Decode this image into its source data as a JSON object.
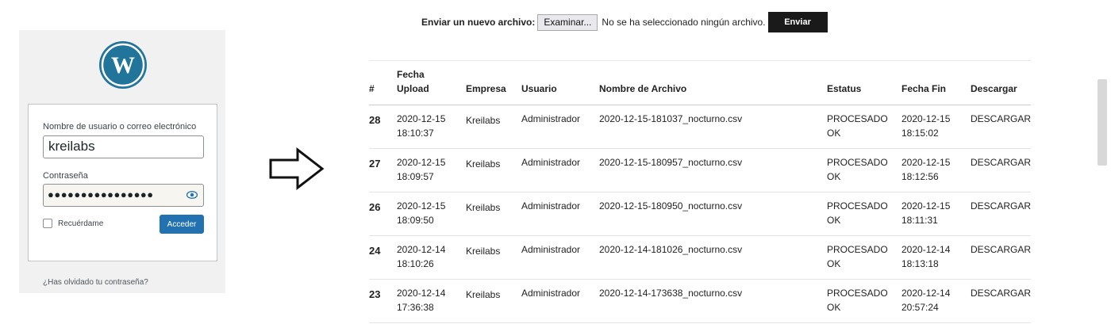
{
  "login": {
    "username_label": "Nombre de usuario o correo electrónico",
    "username_value": "kreilabs",
    "password_label": "Contraseña",
    "password_mask": "●●●●●●●●●●●●●●●●",
    "remember_label": "Recuérdame",
    "submit_label": "Acceder",
    "lost_password": "¿Has olvidado tu contraseña?",
    "brand_color": "#21759b"
  },
  "upload": {
    "label": "Enviar un nuevo archivo:",
    "browse_label": "Examinar...",
    "no_file_text": "No se ha seleccionado ningún archivo.",
    "send_label": "Enviar"
  },
  "table": {
    "headers": {
      "num": "#",
      "fecha_upload_1": "Fecha",
      "fecha_upload_2": "Upload",
      "empresa": "Empresa",
      "usuario": "Usuario",
      "archivo": "Nombre de Archivo",
      "estatus": "Estatus",
      "fecha_fin": "Fecha Fin",
      "descargar": "Descargar"
    },
    "rows": [
      {
        "num": "28",
        "upload_date": "2020-12-15",
        "upload_time": "18:10:37",
        "empresa": "Kreilabs",
        "usuario": "Administrador",
        "archivo": "2020-12-15-181037_nocturno.csv",
        "estatus_1": "PROCESADO",
        "estatus_2": "OK",
        "fin_date": "2020-12-15",
        "fin_time": "18:15:02",
        "descargar": "DESCARGAR"
      },
      {
        "num": "27",
        "upload_date": "2020-12-15",
        "upload_time": "18:09:57",
        "empresa": "Kreilabs",
        "usuario": "Administrador",
        "archivo": "2020-12-15-180957_nocturno.csv",
        "estatus_1": "PROCESADO",
        "estatus_2": "OK",
        "fin_date": "2020-12-15",
        "fin_time": "18:12:56",
        "descargar": "DESCARGAR"
      },
      {
        "num": "26",
        "upload_date": "2020-12-15",
        "upload_time": "18:09:50",
        "empresa": "Kreilabs",
        "usuario": "Administrador",
        "archivo": "2020-12-15-180950_nocturno.csv",
        "estatus_1": "PROCESADO",
        "estatus_2": "OK",
        "fin_date": "2020-12-15",
        "fin_time": "18:11:31",
        "descargar": "DESCARGAR"
      },
      {
        "num": "24",
        "upload_date": "2020-12-14",
        "upload_time": "18:10:26",
        "empresa": "Kreilabs",
        "usuario": "Administrador",
        "archivo": "2020-12-14-181026_nocturno.csv",
        "estatus_1": "PROCESADO",
        "estatus_2": "OK",
        "fin_date": "2020-12-14",
        "fin_time": "18:13:18",
        "descargar": "DESCARGAR"
      },
      {
        "num": "23",
        "upload_date": "2020-12-14",
        "upload_time": "17:36:38",
        "empresa": "Kreilabs",
        "usuario": "Administrador",
        "archivo": "2020-12-14-173638_nocturno.csv",
        "estatus_1": "PROCESADO",
        "estatus_2": "OK",
        "fin_date": "2020-12-14",
        "fin_time": "20:57:24",
        "descargar": "DESCARGAR"
      }
    ]
  },
  "icons": {
    "logo": "wordpress-logo",
    "eye": "eye-icon",
    "arrow": "right-arrow-outline"
  }
}
